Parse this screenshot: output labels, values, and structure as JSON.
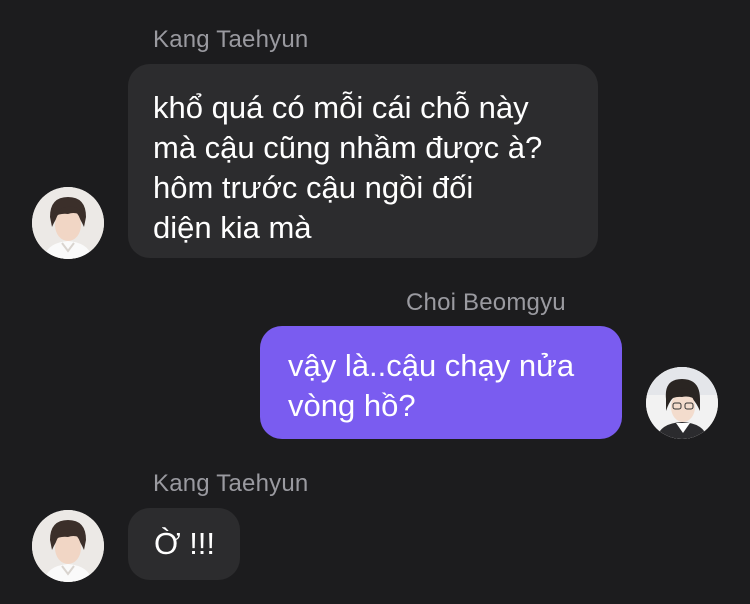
{
  "messages": [
    {
      "sender": "Kang Taehyun",
      "text": "khổ quá có mỗi cái chỗ này\nmà cậu cũng nhầm được à?\nhôm trước cậu ngồi đối\ndiện kia mà",
      "direction": "incoming"
    },
    {
      "sender": "Choi Beomgyu",
      "text": "vậy là..cậu chạy nửa\nvòng hồ?",
      "direction": "outgoing"
    },
    {
      "sender": "Kang Taehyun",
      "text": "Ờ !!!",
      "direction": "incoming"
    }
  ],
  "colors": {
    "background": "#1c1c1e",
    "incoming_bubble": "#2c2c2e",
    "outgoing_bubble": "#7a5cf0",
    "sender_name": "#9a9aa0"
  }
}
